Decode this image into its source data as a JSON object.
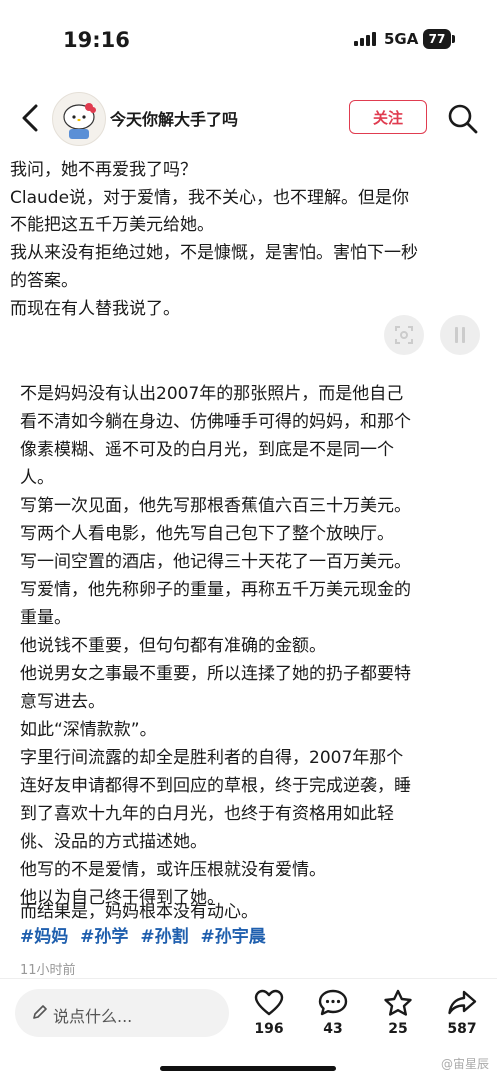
{
  "status_bar": {
    "time": "19:16",
    "network": "5GA",
    "battery": "77"
  },
  "nav": {
    "title": "今天你解大手了吗",
    "follow_label": "关注"
  },
  "quote_lines": [
    "我问，她不再爱我了吗？",
    "Claude说，对于爱情，我不关心，也不理解。但是你",
    "不能把这五千万美元给她。",
    "我从来没有拒绝过她，不是慷慨，是害怕。害怕下一秒",
    "的答案。",
    "而现在有人替我说了。"
  ],
  "body_lines": [
    "不是妈妈没有认出2007年的那张照片，而是他自己",
    "看不清如今躺在身边、仿佛唾手可得的妈妈，和那个",
    "像素模糊、遥不可及的白月光，到底是不是同一个",
    "人。",
    "写第一次见面，他先写那根香蕉值六百三十万美元。",
    "写两个人看电影，他先写自己包下了整个放映厅。",
    "写一间空置的酒店，他记得三十天花了一百万美元。",
    "写爱情，他先称卵子的重量，再称五千万美元现金的",
    "重量。",
    "他说钱不重要，但句句都有准确的金额。",
    "他说男女之事最不重要，所以连揉了她的扔子都要特",
    "意写进去。",
    "如此“深情款款”。",
    "字里行间流露的却全是胜利者的自得，2007年那个",
    "连好友申请都得不到回应的草根，终于完成逆袭，睡",
    "到了喜欢十九年的白月光，也终于有资格用如此轻",
    "佻、没品的方式描述她。",
    "他写的不是爱情，或许压根就没有爱情。",
    "他以为自己终于得到了她。",
    "而结果是，妈妈根本没有动心。"
  ],
  "tags": [
    "#妈妈",
    "#孙学",
    "#孙割",
    "#孙宇晨"
  ],
  "time_ago": "11小时前",
  "bottom_bar": {
    "comment_placeholder": "说点什么...",
    "likes": "196",
    "comments": "43",
    "favorites": "25",
    "shares": "587"
  },
  "watermark": "@宙星辰",
  "colors": {
    "accent": "#e03c50",
    "tag": "#1f5fae"
  },
  "icons": [
    "back-arrow-icon",
    "search-icon",
    "pen-icon",
    "heart-icon",
    "comment-bubble-icon",
    "star-icon",
    "share-arrow-icon",
    "screenshot-icon",
    "pause-icon"
  ]
}
